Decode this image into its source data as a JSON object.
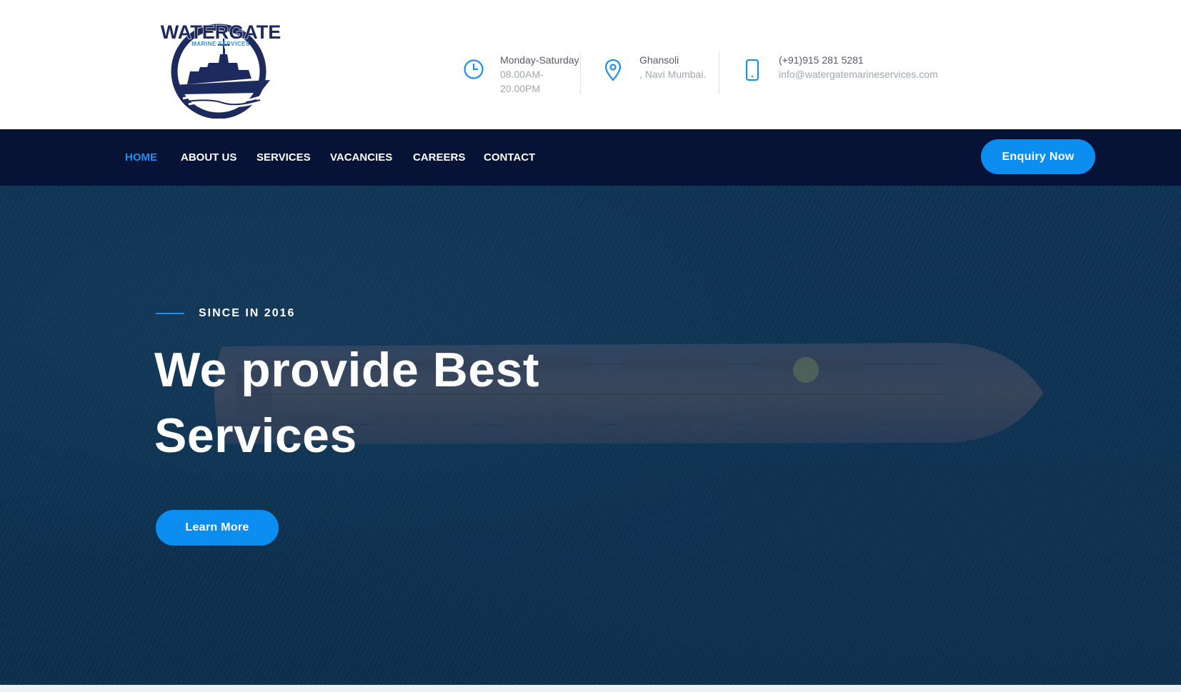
{
  "logo": {
    "name": "WATERGATE",
    "tagline": "MARINE SERVICES"
  },
  "header": {
    "hours": {
      "label": "Monday-Saturday",
      "time_line1": "08.00AM-",
      "time_line2": "20.00PM",
      "icon": "clock-icon"
    },
    "location": {
      "line1": "Ghansoli",
      "line2": ", Navi Mumbai.",
      "icon": "map-pin-icon"
    },
    "contact": {
      "phone": "(+91)915 281 5281",
      "email": "info@watergatemarineservices.com",
      "icon": "mobile-phone-icon"
    }
  },
  "nav": {
    "items": [
      {
        "label": "HOME",
        "active": true
      },
      {
        "label": "ABOUT US",
        "active": false
      },
      {
        "label": "SERVICES",
        "active": false
      },
      {
        "label": "VACANCIES",
        "active": false
      },
      {
        "label": "CAREERS",
        "active": false
      },
      {
        "label": "CONTACT",
        "active": false
      }
    ],
    "cta_label": "Enquiry Now"
  },
  "hero": {
    "eyebrow": "SINCE IN 2016",
    "headline_line1": "We provide Best",
    "headline_line2": "Services",
    "button_label": "Learn More"
  },
  "colors": {
    "accent": "#0b8ef0",
    "nav_bg": "#061236",
    "hero_bg": "#0d3354",
    "logo_navy": "#1d2a5e"
  }
}
